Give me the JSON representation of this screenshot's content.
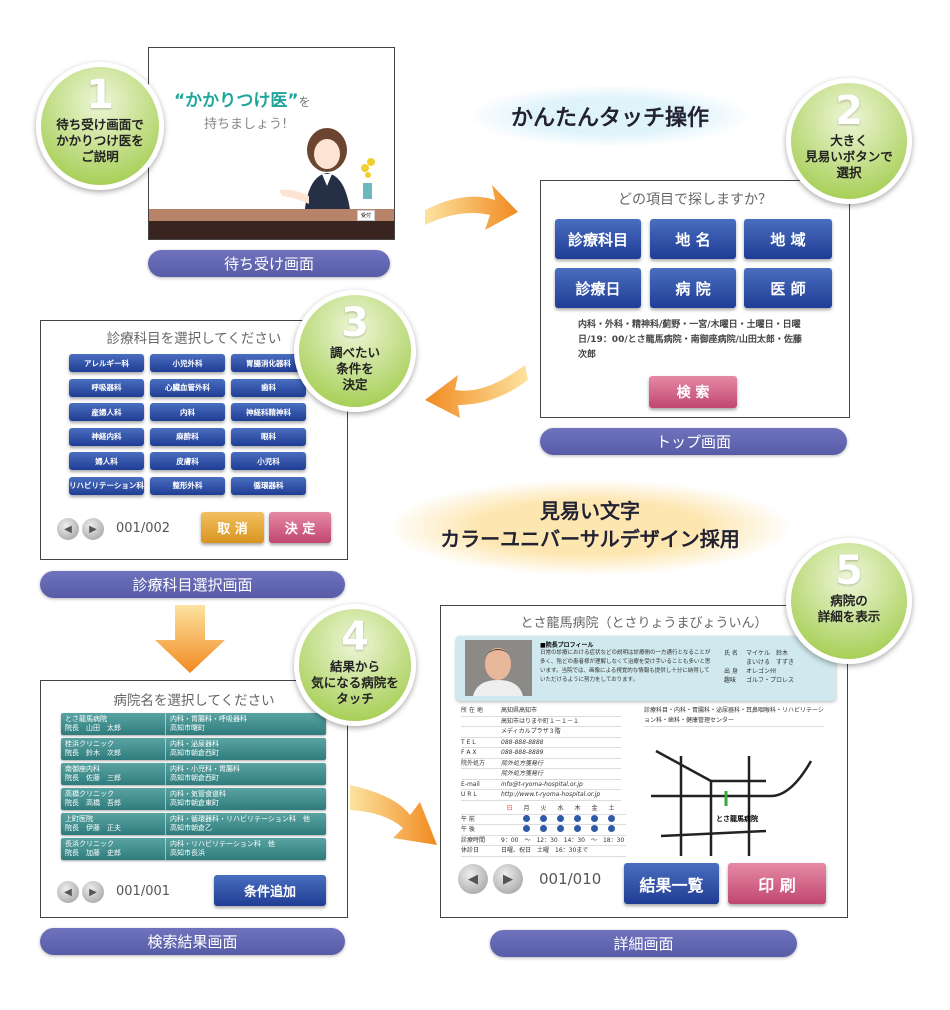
{
  "banners": {
    "touch": "かんたんタッチ操作",
    "design_line1": "見易い文字",
    "design_line2": "カラーユニバーサルデザイン採用"
  },
  "steps": [
    {
      "num": "1",
      "lines": [
        "待ち受け画面で",
        "かかりつけ医を",
        "ご説明"
      ]
    },
    {
      "num": "2",
      "lines": [
        "大きく",
        "見易いボタンで",
        "選択"
      ]
    },
    {
      "num": "3",
      "lines": [
        "調べたい",
        "条件を",
        "決定"
      ]
    },
    {
      "num": "4",
      "lines": [
        "結果から",
        "気になる病院を",
        "タッチ"
      ]
    },
    {
      "num": "5",
      "lines": [
        "病院の",
        "詳細を表示"
      ]
    }
  ],
  "screen_standby": {
    "label": "待ち受け画面",
    "headline": "“かかりつけ医”",
    "headline_suffix": "を",
    "subline": "持ちましょう!",
    "desk_sign": "受付"
  },
  "screen_top": {
    "label": "トップ画面",
    "title": "どの項目で探しますか？",
    "buttons": [
      "診療科目",
      "地 名",
      "地 域",
      "診療日",
      "病 院",
      "医 師"
    ],
    "conditions": "内科・外科・精神科/薊野・一宮/木曜日・土曜日・日曜日/19：00/とさ龍馬病院・南御座病院/山田太郎・佐藤次郎",
    "search_button": "検 索"
  },
  "screen_dept": {
    "label": "診療科目選択画面",
    "title": "診療科目を選択してください",
    "departments": [
      "アレルギー科",
      "小児外科",
      "胃腸消化器科",
      "呼吸器科",
      "心臓血管外科",
      "歯科",
      "産婦人科",
      "内科",
      "神経科精神科",
      "神経内科",
      "麻酔科",
      "眼科",
      "婦人科",
      "皮膚科",
      "小児科",
      "リハビリテーション科",
      "整形外科",
      "循環器科"
    ],
    "page": "001/002",
    "cancel_button": "取 消",
    "confirm_button": "決 定"
  },
  "screen_results": {
    "label": "検索結果画面",
    "title": "病院名を選択してください",
    "rows": [
      {
        "name": "とさ龍馬病院",
        "director": "院長　山田　太郎",
        "depts": "内科・胃腸科・呼吸器科",
        "address": "高知市曙町"
      },
      {
        "name": "桂浜クリニック",
        "director": "院長　鈴木　次郎",
        "depts": "内科・泌尿器科",
        "address": "高知市朝倉西町"
      },
      {
        "name": "南御座内科",
        "director": "院長　佐藤　三郎",
        "depts": "内科・小児科・胃腸科",
        "address": "高知市朝倉西町"
      },
      {
        "name": "高橋クリニック",
        "director": "院長　高橋　吾郎",
        "depts": "内科・気管食道科",
        "address": "高知市朝倉東町"
      },
      {
        "name": "上町医院",
        "director": "院長　伊藤　正夫",
        "depts": "内科・循環器科・リハビリテーション科　他",
        "address": "高知市朝倉乙"
      },
      {
        "name": "長浜クリニック",
        "director": "院長　加藤　史郎",
        "depts": "内科・リハビリテーション科　他",
        "address": "高知市長浜"
      }
    ],
    "page": "001/001",
    "add_condition_button": "条件追加"
  },
  "screen_detail": {
    "label": "詳細画面",
    "title": "とさ龍馬病院（とさりょうまびょういん）",
    "profile_heading": "■院長プロフィール",
    "profile_text": "日常の診療における症状などの説明は診療側の一方通行となることが多く、殆どの患者様が理解しなくて治療を受け手いることも多いと思います。当院では、画像による視覚的な情報も提供し十分に納得していただけるように努力をしております。",
    "profile_facts": [
      {
        "k": "氏 名",
        "v": "マイケル　鈴木"
      },
      {
        "k": "",
        "v": "まいける　すずき"
      },
      {
        "k": "出 身",
        "v": "オレゴン州"
      },
      {
        "k": "趣味",
        "v": "ゴルフ・プロレス"
      }
    ],
    "info": [
      {
        "k": "所 在 地",
        "v": "高知県高知市"
      },
      {
        "k": "",
        "v": "高知市はりまや町１－１－１"
      },
      {
        "k": "",
        "v": "メディカルプラザ３階"
      },
      {
        "k": "T E L",
        "v": "088-888-8888"
      },
      {
        "k": "F A X",
        "v": "088-888-8889"
      },
      {
        "k": "院外処方",
        "v": "院外処方箋発行"
      },
      {
        "k": "",
        "v": "院外処方箋発行"
      },
      {
        "k": "E-mail",
        "v": "info@t-ryoma-hospital.or.jp"
      },
      {
        "k": "U R L",
        "v": "http://www.t-ryoma-hospital.or.jp"
      }
    ],
    "departments_text": "診療科目・内科・胃腸科・泌尿器科・耳鼻咽喉科・リハビリテーション科・歯科・健康管理センター",
    "days": [
      "日",
      "月",
      "火",
      "水",
      "木",
      "金",
      "土"
    ],
    "am_label": "午 前",
    "pm_label": "午 後",
    "hours_label": "診療時間",
    "hours": "9：00　～　12：30　14：30　～　18：30",
    "closed_label": "休診日",
    "closed": "日曜、祝日　土曜　16：30まで",
    "map_label": "とさ龍馬病院",
    "page": "001/010",
    "results_button": "結果一覧",
    "print_button": "印 刷"
  },
  "colors": {
    "pill": "#6266b0",
    "blue_button": "#2a4aa0",
    "pink_button": "#c94f78",
    "orange_button": "#e0a030",
    "teal_row": "#3f8c8c",
    "step_circle": "#a9d05a",
    "headline_teal": "#1fa59a"
  }
}
